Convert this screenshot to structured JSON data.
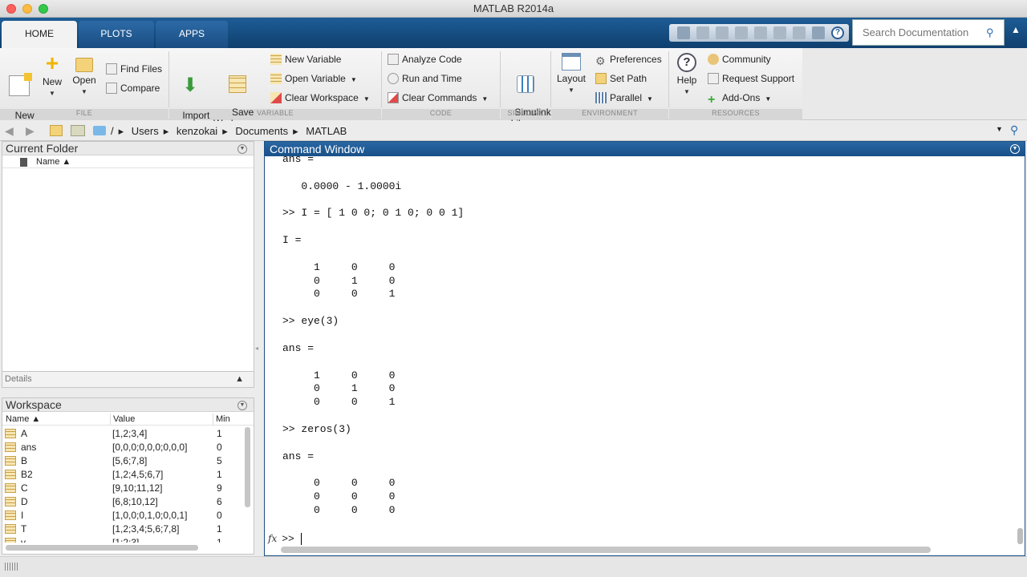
{
  "window": {
    "title": "MATLAB R2014a"
  },
  "tabs": [
    {
      "label": "HOME"
    },
    {
      "label": "PLOTS"
    },
    {
      "label": "APPS"
    }
  ],
  "search": {
    "placeholder": "Search Documentation"
  },
  "ribbon": {
    "file": {
      "label": "FILE",
      "new_script": "New\nScript",
      "new": "New",
      "open": "Open",
      "find_files": "Find Files",
      "compare": "Compare"
    },
    "variable": {
      "label": "VARIABLE",
      "import_data": "Import\nData",
      "save_workspace": "Save\nWorkspace",
      "new_variable": "New Variable",
      "open_variable": "Open Variable",
      "clear_workspace": "Clear Workspace"
    },
    "code": {
      "label": "CODE",
      "analyze_code": "Analyze Code",
      "run_and_time": "Run and Time",
      "clear_commands": "Clear Commands"
    },
    "simulink": {
      "label": "SIMULINK",
      "simulink_library": "Simulink\nLibrary"
    },
    "environment": {
      "label": "ENVIRONMENT",
      "layout": "Layout",
      "preferences": "Preferences",
      "set_path": "Set Path",
      "parallel": "Parallel"
    },
    "resources": {
      "label": "RESOURCES",
      "help": "Help",
      "community": "Community",
      "request_support": "Request Support",
      "add_ons": "Add-Ons"
    }
  },
  "address": {
    "root": "/",
    "segments": [
      "Users",
      "kenzokai",
      "Documents",
      "MATLAB"
    ]
  },
  "current_folder": {
    "title": "Current Folder",
    "column_name": "Name ▲",
    "details_label": "Details"
  },
  "workspace": {
    "title": "Workspace",
    "columns": {
      "name": "Name ▲",
      "value": "Value",
      "min": "Min"
    },
    "rows": [
      {
        "name": "A",
        "value": "[1,2;3,4]",
        "min": "1"
      },
      {
        "name": "ans",
        "value": "[0,0,0;0,0,0;0,0,0]",
        "min": "0"
      },
      {
        "name": "B",
        "value": "[5,6;7,8]",
        "min": "5"
      },
      {
        "name": "B2",
        "value": "[1,2;4,5;6,7]",
        "min": "1"
      },
      {
        "name": "C",
        "value": "[9,10;11,12]",
        "min": "9"
      },
      {
        "name": "D",
        "value": "[6,8;10,12]",
        "min": "6"
      },
      {
        "name": "I",
        "value": "[1,0,0;0,1,0;0,0,1]",
        "min": "0"
      },
      {
        "name": "T",
        "value": "[1,2;3,4;5,6;7,8]",
        "min": "1"
      },
      {
        "name": "v",
        "value": "[1;2;3]",
        "min": "1"
      }
    ]
  },
  "command_window": {
    "title": "Command Window",
    "lines": [
      "ans =",
      "",
      "   0.0000 - 1.0000i",
      "",
      ">> I = [ 1 0 0; 0 1 0; 0 0 1]",
      "",
      "I =",
      "",
      "     1     0     0",
      "     0     1     0",
      "     0     0     1",
      "",
      ">> eye(3)",
      "",
      "ans =",
      "",
      "     1     0     0",
      "     0     1     0",
      "     0     0     1",
      "",
      ">> zeros(3)",
      "",
      "ans =",
      "",
      "     0     0     0",
      "     0     0     0",
      "     0     0     0"
    ],
    "prompt": ">> ",
    "fx_label": "fx"
  }
}
